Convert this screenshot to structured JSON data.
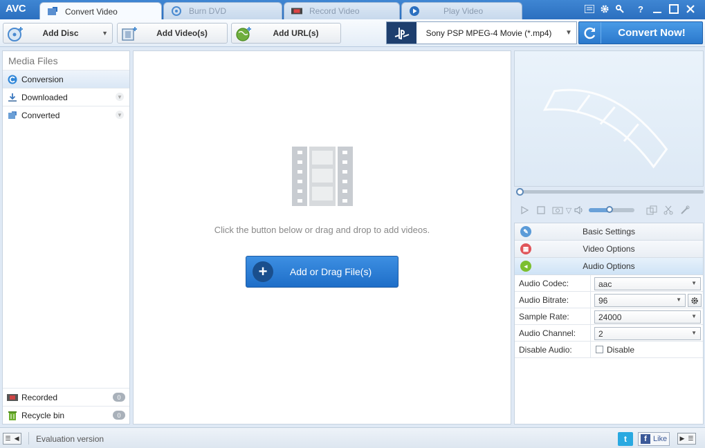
{
  "app": {
    "logo": "AVC"
  },
  "tabs": [
    {
      "label": "Convert Video",
      "icon": "convert-icon",
      "active": true
    },
    {
      "label": "Burn DVD",
      "icon": "disc-icon",
      "active": false
    },
    {
      "label": "Record Video",
      "icon": "record-icon",
      "active": false
    },
    {
      "label": "Play Video",
      "icon": "play-icon",
      "active": false
    }
  ],
  "window_controls": {
    "help": "?"
  },
  "toolbar": {
    "add_disc": "Add Disc",
    "add_videos": "Add Video(s)",
    "add_urls": "Add URL(s)",
    "profile": "Sony PSP MPEG-4 Movie (*.mp4)",
    "convert_now": "Convert Now!"
  },
  "left_panel": {
    "title": "Media Files",
    "items": [
      {
        "label": "Conversion",
        "selected": true
      },
      {
        "label": "Downloaded",
        "selected": false
      },
      {
        "label": "Converted",
        "selected": false
      }
    ],
    "bottom_items": [
      {
        "label": "Recorded",
        "count": "0"
      },
      {
        "label": "Recycle bin",
        "count": "0"
      }
    ]
  },
  "center": {
    "hint": "Click the button below or drag and drop to add videos.",
    "add_button": "Add or Drag File(s)"
  },
  "player": {
    "volume": 0.45,
    "position": 0.0
  },
  "settings": {
    "sections": [
      {
        "label": "Basic Settings",
        "color": "#5b9bd8"
      },
      {
        "label": "Video Options",
        "color": "#e0555a"
      },
      {
        "label": "Audio Options",
        "color": "#7cbf2f"
      }
    ],
    "audio_rows": [
      {
        "label": "Audio Codec:",
        "value": "aac"
      },
      {
        "label": "Audio Bitrate:",
        "value": "96"
      },
      {
        "label": "Sample Rate:",
        "value": "24000"
      },
      {
        "label": "Audio Channel:",
        "value": "2"
      }
    ],
    "disable_audio": {
      "label": "Disable Audio:",
      "checkbox_label": "Disable",
      "checked": false
    }
  },
  "statusbar": {
    "text": "Evaluation version",
    "twitter": "t",
    "facebook_like": "Like"
  },
  "colors": {
    "accent": "#2b6fbf",
    "button_blue": "#2a78cc"
  }
}
